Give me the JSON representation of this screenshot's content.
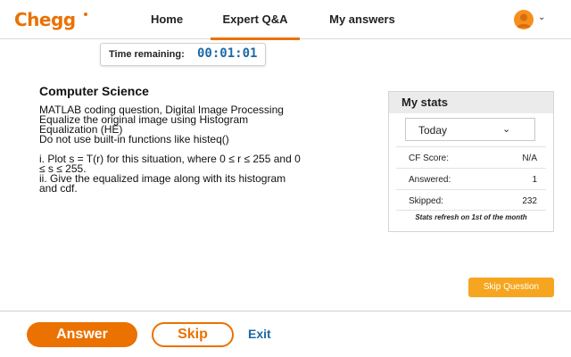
{
  "header": {
    "logo": "Chegg",
    "nav": [
      {
        "label": "Home"
      },
      {
        "label": "Expert Q&A",
        "active": true
      },
      {
        "label": "My answers"
      }
    ],
    "avatar_icon": "user-avatar-icon",
    "avatar_chevron": "⌄"
  },
  "timer": {
    "label": "Time remaining:",
    "value": "00:01:01"
  },
  "question": {
    "subject": "Computer Science",
    "lines": [
      "MATLAB coding question, Digital Image Processing",
      "Equalize the original image using Histogram",
      "Equalization (HE)",
      "Do not use built-in functions like histeq()",
      "",
      "i. Plot s = T(r) for this situation, where 0 ≤ r ≤ 255 and 0",
      "≤ s ≤ 255.",
      "ii. Give the equalized image along with its histogram",
      "and cdf."
    ]
  },
  "stats": {
    "title": "My stats",
    "period": "Today",
    "period_chevron": "⌄",
    "rows": [
      {
        "label": "CF Score:",
        "value": "N/A"
      },
      {
        "label": "Answered:",
        "value": "1"
      },
      {
        "label": "Skipped:",
        "value": "232"
      }
    ],
    "note": "Stats refresh on 1st of the month"
  },
  "skip_question_label": "Skip Question",
  "footer": {
    "answer_label": "Answer",
    "skip_label": "Skip",
    "exit_label": "Exit"
  },
  "colors": {
    "brand": "#eb7100",
    "link": "#1c6aa6",
    "skip_question": "#f5a51f"
  }
}
